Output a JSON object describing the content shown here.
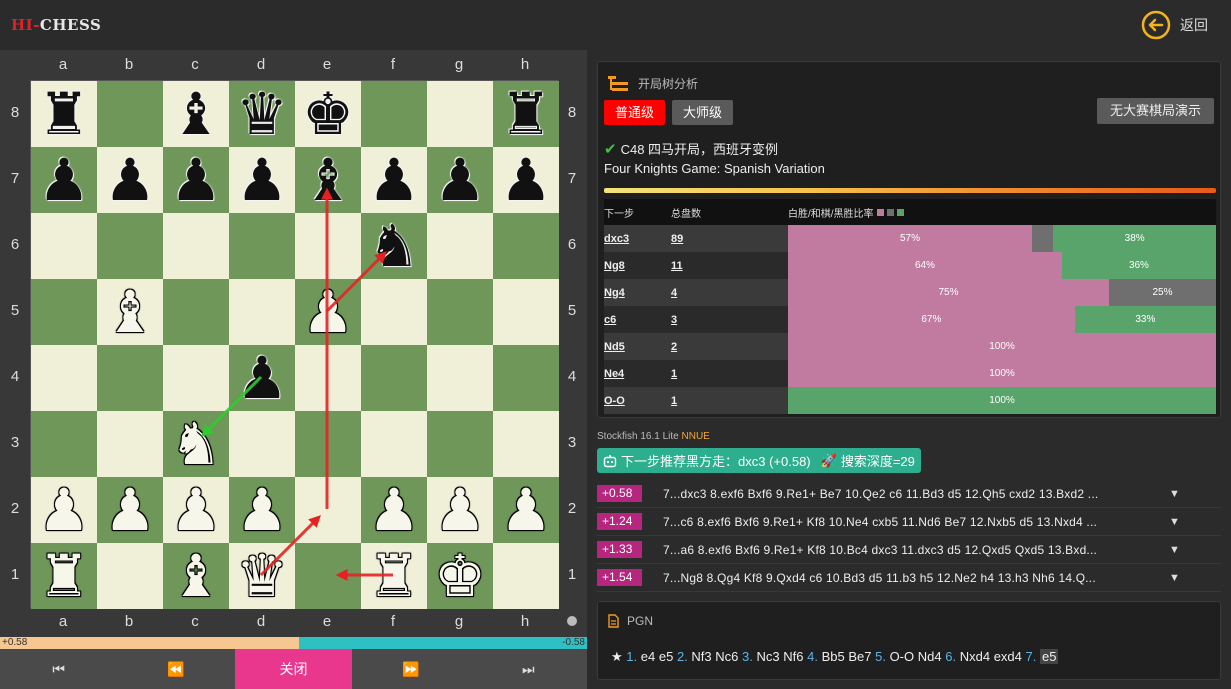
{
  "header": {
    "logo_hi": "HI-",
    "logo_chess": "CHESS",
    "back_label": "返回"
  },
  "board": {
    "files": [
      "a",
      "b",
      "c",
      "d",
      "e",
      "f",
      "g",
      "h"
    ],
    "ranks": [
      "8",
      "7",
      "6",
      "5",
      "4",
      "3",
      "2",
      "1"
    ],
    "position": [
      [
        "br",
        "",
        "bb",
        "bq",
        "bk",
        "",
        "",
        "br"
      ],
      [
        "bp",
        "bp",
        "bp",
        "bp",
        "bb",
        "bp",
        "bp",
        "bp"
      ],
      [
        "",
        "",
        "",
        "",
        "",
        "bn",
        "",
        ""
      ],
      [
        "",
        "wb",
        "",
        "",
        "wp",
        "",
        "",
        ""
      ],
      [
        "",
        "",
        "",
        "bp",
        "",
        "",
        "",
        ""
      ],
      [
        "",
        "",
        "wn",
        "",
        "",
        "",
        "",
        ""
      ],
      [
        "wp",
        "wp",
        "wp",
        "wp",
        "",
        "wp",
        "wp",
        "wp"
      ],
      [
        "wr",
        "",
        "wb",
        "wq",
        "",
        "wr",
        "wk",
        ""
      ]
    ],
    "arrows": [
      {
        "from": "e5",
        "to": "f6",
        "color": "#e52222"
      },
      {
        "from": "d4",
        "to": "c3",
        "color": "#2ecc2e"
      },
      {
        "from": "e2",
        "to": "e7",
        "color": "#e52222"
      },
      {
        "from": "d1",
        "to": "e2",
        "color": "#e52222"
      },
      {
        "from": "f1",
        "to": "e1",
        "color": "#e52222"
      }
    ]
  },
  "eval": {
    "white_label": "+0.58",
    "black_label": "-0.58",
    "white_share": 0.51
  },
  "nav": {
    "first": "⏮",
    "prev": "⏪",
    "close": "关闭",
    "next": "⏩",
    "last": "⏭"
  },
  "opening": {
    "title": "开局树分析",
    "level_normal": "普通级",
    "level_master": "大师级",
    "demo": "无大赛棋局演示",
    "name_cn": "C48 四马开局，西班牙变例",
    "name_en": "Four Knights Game: Spanish Variation",
    "col_move": "下一步",
    "col_total": "总盘数",
    "col_ratio": "白胜/和棋/黑胜比率",
    "colors": {
      "white": "#c27ba0",
      "draw": "#6f6f6f",
      "black": "#58a46a"
    },
    "rows": [
      {
        "move": "dxc3",
        "total": "89",
        "w": 57,
        "d": 5,
        "b": 38,
        "wl": "57%",
        "dl": "",
        "bl": "38%"
      },
      {
        "move": "Ng8",
        "total": "11",
        "w": 64,
        "d": 0,
        "b": 36,
        "wl": "64%",
        "dl": "",
        "bl": "36%"
      },
      {
        "move": "Ng4",
        "total": "4",
        "w": 75,
        "d": 25,
        "b": 0,
        "wl": "75%",
        "dl": "25%",
        "bl": ""
      },
      {
        "move": "c6",
        "total": "3",
        "w": 67,
        "d": 0,
        "b": 33,
        "wl": "67%",
        "dl": "",
        "bl": "33%"
      },
      {
        "move": "Nd5",
        "total": "2",
        "w": 100,
        "d": 0,
        "b": 0,
        "wl": "100%",
        "dl": "",
        "bl": ""
      },
      {
        "move": "Ne4",
        "total": "1",
        "w": 100,
        "d": 0,
        "b": 0,
        "wl": "100%",
        "dl": "",
        "bl": ""
      },
      {
        "move": "O-O",
        "total": "1",
        "w": 0,
        "d": 0,
        "b": 100,
        "wl": "",
        "dl": "",
        "bl": "100%"
      }
    ]
  },
  "engine": {
    "name": "Stockfish 16.1 Lite",
    "nnue": "NNUE",
    "recommend": "下一步推荐黑方走：dxc3 (+0.58)",
    "depth": "搜索深度=29",
    "lines": [
      {
        "score": "+0.58",
        "moves": "7...dxc3 8.exf6 Bxf6 9.Re1+ Be7 10.Qe2 c6 11.Bd3 d5 12.Qh5 cxd2 13.Bxd2 ..."
      },
      {
        "score": "+1.24",
        "moves": "7...c6 8.exf6 Bxf6 9.Re1+ Kf8 10.Ne4 cxb5 11.Nd6 Be7 12.Nxb5 d5 13.Nxd4 ..."
      },
      {
        "score": "+1.33",
        "moves": "7...a6 8.exf6 Bxf6 9.Re1+ Kf8 10.Bc4 dxc3 11.dxc3 d5 12.Qxd5 Qxd5 13.Bxd..."
      },
      {
        "score": "+1.54",
        "moves": "7...Ng8 8.Qg4 Kf8 9.Qxd4 c6 10.Bd3 d5 11.b3 h5 12.Ne2 h4 13.h3 Nh6 14.Q..."
      }
    ]
  },
  "pgn": {
    "title": "PGN",
    "star": "★",
    "moves": [
      {
        "num": "1.",
        "w": "e4",
        "b": "e5"
      },
      {
        "num": "2.",
        "w": "Nf3",
        "b": "Nc6"
      },
      {
        "num": "3.",
        "w": "Nc3",
        "b": "Nf6"
      },
      {
        "num": "4.",
        "w": "Bb5",
        "b": "Be7"
      },
      {
        "num": "5.",
        "w": "O-O",
        "b": "Nd4"
      },
      {
        "num": "6.",
        "w": "Nxd4",
        "b": "exd4"
      },
      {
        "num": "7.",
        "w": "e5",
        "b": ""
      }
    ]
  }
}
